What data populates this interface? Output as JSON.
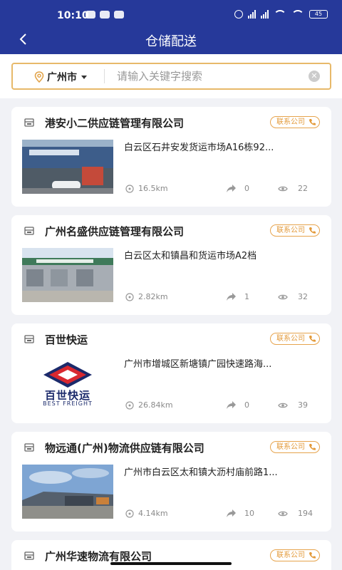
{
  "status": {
    "time": "10:10",
    "battery": "45"
  },
  "header": {
    "title": "仓储配送"
  },
  "search": {
    "city": "广州市",
    "placeholder": "请输入关键字搜索"
  },
  "contact_label": "联系公司",
  "companies": [
    {
      "name": "港安小二供应链管理有限公司",
      "address": "白云区石井安发货运市场A16栋92...",
      "distance": "16.5km",
      "shares": "0",
      "views": "22"
    },
    {
      "name": "广州名盛供应链管理有限公司",
      "address": "白云区太和镇昌和货运市场A2档",
      "distance": "2.82km",
      "shares": "1",
      "views": "32"
    },
    {
      "name": "百世快运",
      "address": "广州市增城区新塘镇广园快速路海...",
      "distance": "26.84km",
      "shares": "0",
      "views": "39",
      "logo_cn": "百世快运",
      "logo_en": "BEST FREIGHT"
    },
    {
      "name": "物远通(广州)物流供应链有限公司",
      "address": "广州市白云区太和镇大沥村庙前路1...",
      "distance": "4.14km",
      "shares": "10",
      "views": "194"
    },
    {
      "name": "广州华速物流有限公司"
    }
  ],
  "colors": {
    "header": "#26399a",
    "accent": "#e6a34c"
  }
}
